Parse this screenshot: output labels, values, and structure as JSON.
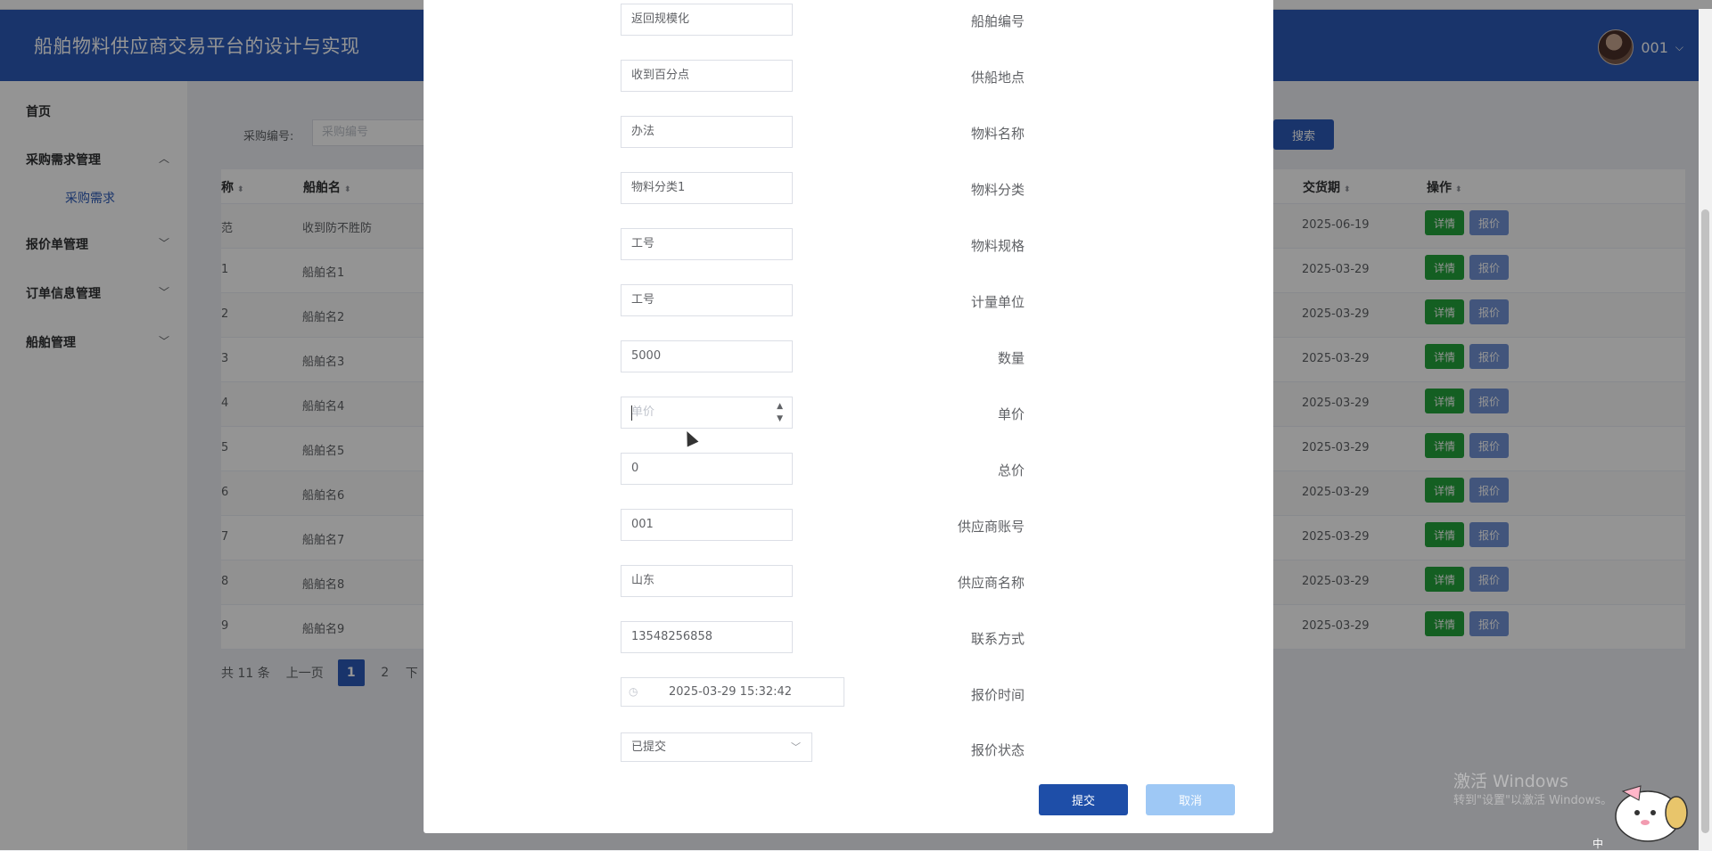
{
  "app": {
    "title": "船舶物料供应商交易平台的设计与实现",
    "user": "001"
  },
  "sidebar": {
    "home": "首页",
    "groups": [
      {
        "label": "采购需求管理",
        "expanded": true,
        "children": [
          "采购需求"
        ]
      },
      {
        "label": "报价单管理",
        "expanded": false
      },
      {
        "label": "订单信息管理",
        "expanded": false
      },
      {
        "label": "船舶管理",
        "expanded": false
      }
    ]
  },
  "search": {
    "label": "采购编号:",
    "placeholder": "采购编号",
    "button": "搜索"
  },
  "table": {
    "columns": {
      "col1_partial": "称",
      "ship": "船舶名",
      "delivery": "交货期",
      "action": "操作"
    },
    "rows": [
      {
        "c1": "范",
        "ship": "收到防不胜防",
        "delivery": "2025-06-19"
      },
      {
        "c1": "1",
        "ship": "船舶名1",
        "delivery": "2025-03-29"
      },
      {
        "c1": "2",
        "ship": "船舶名2",
        "delivery": "2025-03-29"
      },
      {
        "c1": "3",
        "ship": "船舶名3",
        "delivery": "2025-03-29"
      },
      {
        "c1": "4",
        "ship": "船舶名4",
        "delivery": "2025-03-29"
      },
      {
        "c1": "5",
        "ship": "船舶名5",
        "delivery": "2025-03-29"
      },
      {
        "c1": "6",
        "ship": "船舶名6",
        "delivery": "2025-03-29"
      },
      {
        "c1": "7",
        "ship": "船舶名7",
        "delivery": "2025-03-29"
      },
      {
        "c1": "8",
        "ship": "船舶名8",
        "delivery": "2025-03-29"
      },
      {
        "c1": "9",
        "ship": "船舶名9",
        "delivery": "2025-03-29"
      }
    ],
    "detail_label": "详情",
    "quote_label": "报价"
  },
  "pager": {
    "total": "共 11 条",
    "prev": "上一页",
    "pages": [
      "1",
      "2"
    ],
    "next_partial": "下",
    "current": "1"
  },
  "dialog": {
    "fields": [
      {
        "key": "ship_no",
        "label": "船舶编号",
        "value": "返回规模化"
      },
      {
        "key": "location",
        "label": "供船地点",
        "value": "收到百分点"
      },
      {
        "key": "material_name",
        "label": "物料名称",
        "value": "办法"
      },
      {
        "key": "material_category",
        "label": "物料分类",
        "value": "物料分类1"
      },
      {
        "key": "material_spec",
        "label": "物料规格",
        "value": "工号"
      },
      {
        "key": "unit",
        "label": "计量单位",
        "value": "工号"
      },
      {
        "key": "quantity",
        "label": "数量",
        "value": "5000"
      },
      {
        "key": "unit_price",
        "label": "单价",
        "value": "",
        "placeholder": "单价"
      },
      {
        "key": "total_price",
        "label": "总价",
        "value": "0"
      },
      {
        "key": "supplier_account",
        "label": "供应商账号",
        "value": "001"
      },
      {
        "key": "supplier_name",
        "label": "供应商名称",
        "value": "山东"
      },
      {
        "key": "contact",
        "label": "联系方式",
        "value": "13548256858"
      },
      {
        "key": "quote_time",
        "label": "报价时间",
        "value": "2025-03-29 15:32:42"
      },
      {
        "key": "quote_status",
        "label": "报价状态",
        "value": "已提交"
      }
    ],
    "submit": "提交",
    "cancel": "取消"
  },
  "watermark": {
    "title": "激活 Windows",
    "sub": "转到\"设置\"以激活 Windows。"
  },
  "ime": "中",
  "icons": {
    "sort": "sort-icon",
    "chevron": "chevron-icon",
    "clock": "clock-icon",
    "spinner": "spinner-icon"
  }
}
